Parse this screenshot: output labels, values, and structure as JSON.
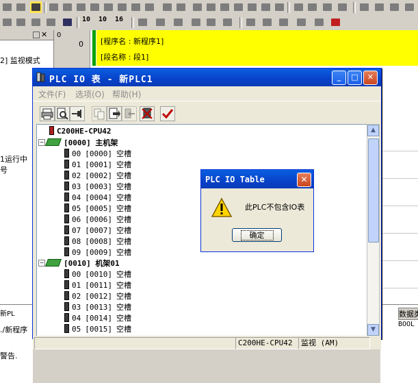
{
  "background": {
    "toolbar_numbers": [
      "10",
      "10",
      "16"
    ],
    "rung_number": "0",
    "rung_start": "0",
    "program_name_line": "[程序名 : 新程序1]",
    "section_name_line": "[段名称 : 段1]",
    "left_pane_lines": [
      "2] 监视模式",
      "1运行中",
      "号"
    ],
    "left_bottom_lines": [
      "新PL",
      "./新程序",
      "警告."
    ],
    "right_bottom_header": "数据类",
    "right_bottom_value": "BOOL"
  },
  "window": {
    "title": "PLC IO 表 - 新PLC1",
    "caption_buttons": {
      "minimize": "_",
      "maximize": "□",
      "close": "✕"
    },
    "menu": [
      {
        "label": "文件(F)"
      },
      {
        "label": "选项(O)"
      },
      {
        "label": "帮助(H)"
      }
    ],
    "tree": {
      "cpu": "C200HE-CPU42",
      "racks": [
        {
          "label": "[0000] 主机架",
          "slots": [
            {
              "slot": "00",
              "addr": "[0000]",
              "status": "空槽"
            },
            {
              "slot": "01",
              "addr": "[0001]",
              "status": "空槽"
            },
            {
              "slot": "02",
              "addr": "[0002]",
              "status": "空槽"
            },
            {
              "slot": "03",
              "addr": "[0003]",
              "status": "空槽"
            },
            {
              "slot": "04",
              "addr": "[0004]",
              "status": "空槽"
            },
            {
              "slot": "05",
              "addr": "[0005]",
              "status": "空槽"
            },
            {
              "slot": "06",
              "addr": "[0006]",
              "status": "空槽"
            },
            {
              "slot": "07",
              "addr": "[0007]",
              "status": "空槽"
            },
            {
              "slot": "08",
              "addr": "[0008]",
              "status": "空槽"
            },
            {
              "slot": "09",
              "addr": "[0009]",
              "status": "空槽"
            }
          ]
        },
        {
          "label": "[0010] 机架01",
          "slots": [
            {
              "slot": "00",
              "addr": "[0010]",
              "status": "空槽"
            },
            {
              "slot": "01",
              "addr": "[0011]",
              "status": "空槽"
            },
            {
              "slot": "02",
              "addr": "[0012]",
              "status": "空槽"
            },
            {
              "slot": "03",
              "addr": "[0013]",
              "status": "空槽"
            },
            {
              "slot": "04",
              "addr": "[0014]",
              "status": "空槽"
            },
            {
              "slot": "05",
              "addr": "[0015]",
              "status": "空槽"
            }
          ]
        }
      ]
    },
    "status": {
      "model": "C200HE-CPU42",
      "mode": "监视 (AM)"
    }
  },
  "message_box": {
    "title": "PLC IO Table",
    "text": "此PLC不包含IO表",
    "ok_label": "确定"
  }
}
